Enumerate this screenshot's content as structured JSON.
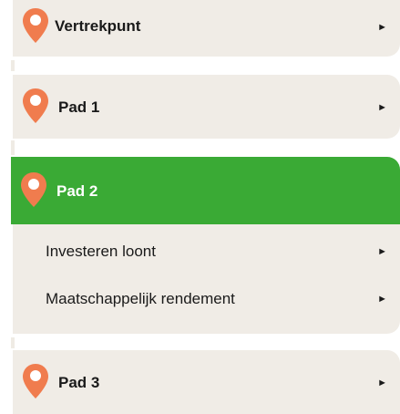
{
  "nav": {
    "items": [
      {
        "label": "Vertrekpunt",
        "arrow": "►",
        "icon": "map-pin-icon"
      },
      {
        "label": "Pad 1",
        "arrow": "►",
        "icon": "map-pin-icon"
      },
      {
        "label": "Pad 2",
        "arrow": "",
        "icon": "map-pin-icon",
        "active": true,
        "subitems": [
          {
            "label": "Investeren loont",
            "arrow": "►"
          },
          {
            "label": "Maatschappelijk rendement",
            "arrow": "►"
          }
        ]
      },
      {
        "label": "Pad 3",
        "arrow": "►",
        "icon": "map-pin-icon"
      }
    ]
  },
  "colors": {
    "pin": "#f07c4e",
    "active": "#3aaa35",
    "card": "#f0ece6"
  }
}
